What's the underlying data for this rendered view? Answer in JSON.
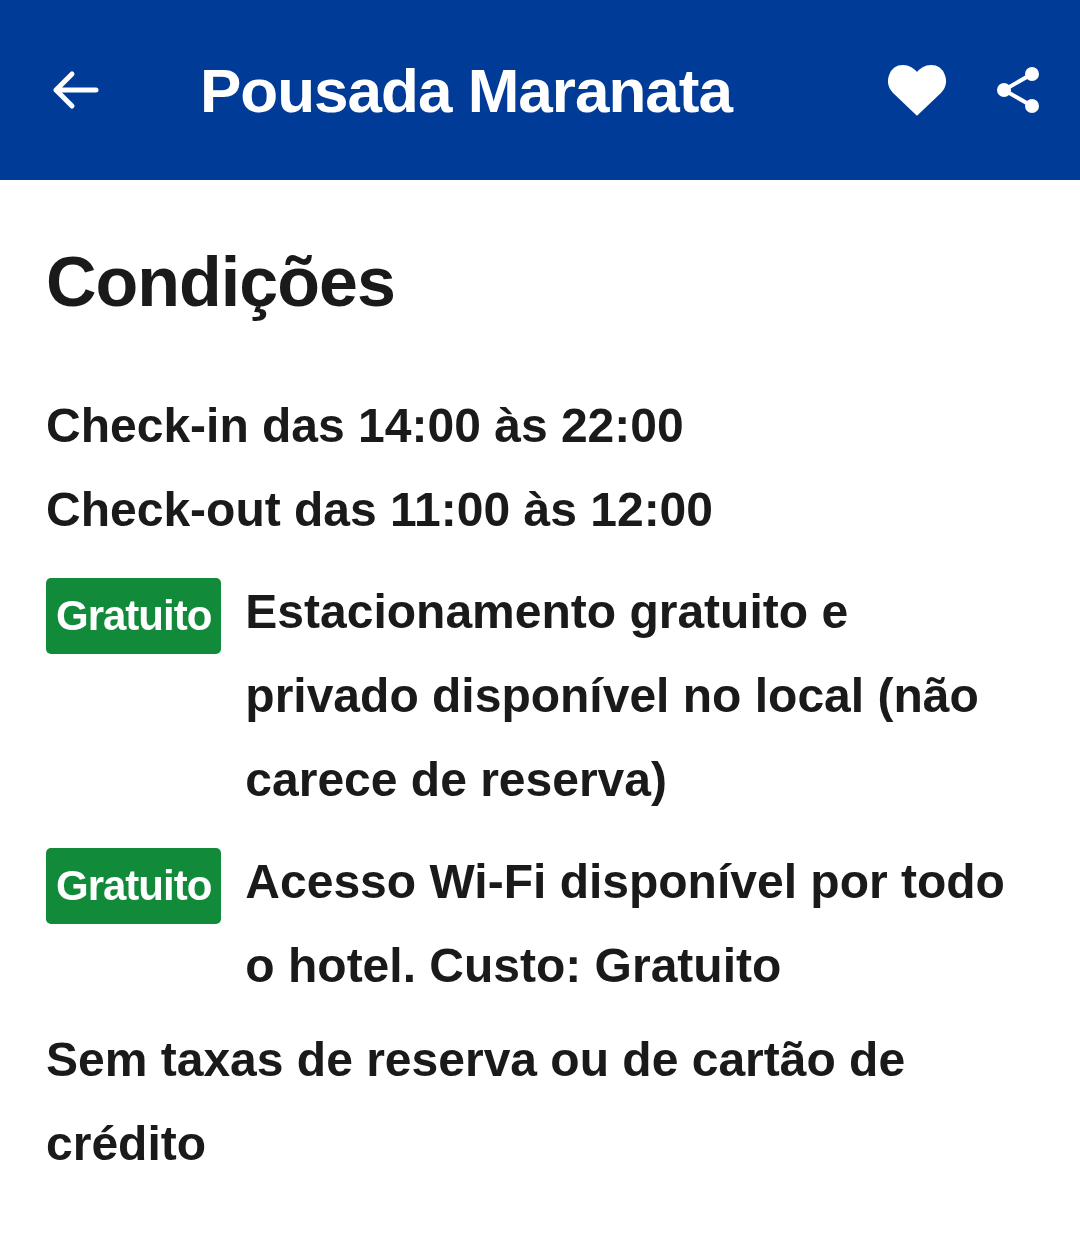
{
  "header": {
    "title": "Pousada Maranata",
    "favorite": true
  },
  "section": {
    "title": "Condições"
  },
  "times": [
    "Check-in das 14:00 às 22:00",
    "Check-out das 11:00 às 12:00"
  ],
  "amenities": [
    {
      "badge": "Gratuito",
      "text": "Estacionamento gratuito e privado disponível no local (não carece de reserva)"
    },
    {
      "badge": "Gratuito",
      "text": "Acesso Wi-Fi disponível por todo o hotel. Custo: Gratuito"
    }
  ],
  "note": "Sem taxas de reserva ou de cartão de crédito"
}
